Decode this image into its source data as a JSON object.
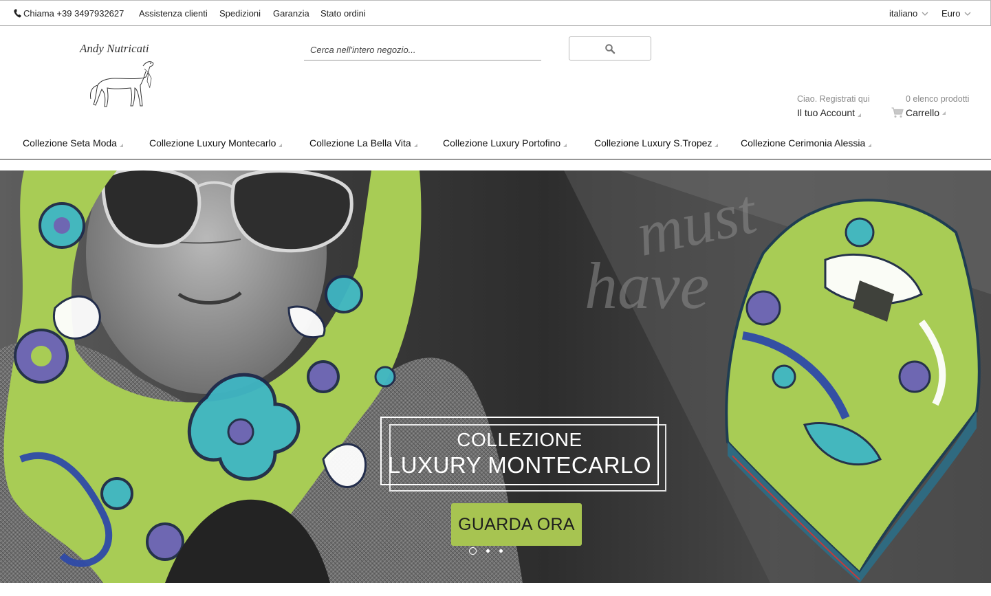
{
  "topbar": {
    "phone_label": "Chiama +39 3497932627",
    "links": [
      "Assistenza clienti",
      "Spedizioni",
      "Garanzia",
      "Stato ordini"
    ],
    "language": "italiano",
    "currency": "Euro"
  },
  "header": {
    "logo_text": "Andy Nutricati",
    "search_placeholder": "Cerca nell'intero negozio...",
    "account_greeting": "Ciao. Registrati qui",
    "account_label": "Il tuo Account",
    "wishlist_count": "0 elenco prodotti",
    "cart_label": "Carrello"
  },
  "nav": {
    "items": [
      "Collezione Seta Moda",
      "Collezione Luxury Montecarlo",
      "Collezione La Bella Vita",
      "Collezione Luxury Portofino",
      "Collezione Luxury S.Tropez",
      "Collezione Cerimonia Alessia"
    ]
  },
  "hero": {
    "line1": "COLLEZIONE",
    "line2": "LUXURY MONTECARLO",
    "cta": "GUARDA ORA",
    "script_text": "must have",
    "slides": 3,
    "active_slide": 1
  },
  "colors": {
    "cta_green": "#a7c451",
    "scarf_green": "#a8cc55",
    "scarf_teal": "#3fb6c4",
    "scarf_violet": "#6b62b8"
  }
}
